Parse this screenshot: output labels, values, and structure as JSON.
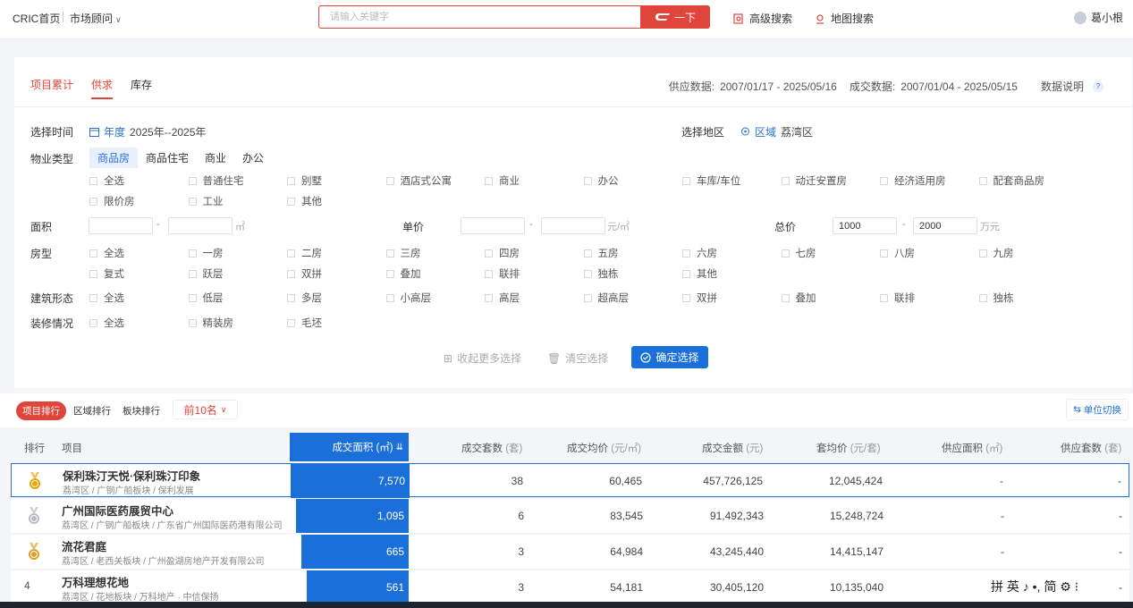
{
  "header": {
    "home": "CRIC首页",
    "advisor": "市场顾问",
    "search_placeholder": "请输入关键字",
    "search_button": "一下",
    "advanced_search": "高级搜索",
    "map_search": "地图搜索",
    "user": "葛小根"
  },
  "tabs": [
    {
      "label": "项目累计"
    },
    {
      "label": "供求"
    },
    {
      "label": "库存"
    }
  ],
  "data_range": {
    "supply_label": "供应数据:",
    "supply_range": "2007/01/17 - 2025/05/16",
    "deal_label": "成交数据:",
    "deal_range": "2007/01/04 - 2025/05/15",
    "note": "数据说明"
  },
  "filters": {
    "time_label": "选择时间",
    "time_type": "年度",
    "time_value": "2025年--2025年",
    "region_label": "选择地区",
    "region_type": "区域",
    "region_value": "荔湾区",
    "property_label": "物业类型",
    "property_types": [
      "商品房",
      "商品住宅",
      "商业",
      "办公"
    ],
    "property_sub": [
      "全选",
      "普通住宅",
      "别墅",
      "酒店式公寓",
      "商业",
      "办公",
      "车库/车位",
      "动迁安置房",
      "经济适用房",
      "配套商品房",
      "限价房",
      "工业",
      "其他"
    ],
    "area_label": "面积",
    "area_unit": "㎡",
    "unit_price_label": "单价",
    "unit_price_unit": "元/㎡",
    "total_price_label": "总价",
    "total_min": "1000",
    "total_max": "2000",
    "total_unit": "万元",
    "room_label": "房型",
    "rooms": [
      "全选",
      "一房",
      "二房",
      "三房",
      "四房",
      "五房",
      "六房",
      "七房",
      "八房",
      "九房",
      "复式",
      "跃层",
      "双拼",
      "叠加",
      "联排",
      "独栋",
      "其他"
    ],
    "building_label": "建筑形态",
    "buildings": [
      "全选",
      "低层",
      "多层",
      "小高层",
      "高层",
      "超高层",
      "双拼",
      "叠加",
      "联排",
      "独栋"
    ],
    "decor_label": "装修情况",
    "decors": [
      "全选",
      "精装房",
      "毛坯"
    ],
    "collapse": "收起更多选择",
    "clear": "清空选择",
    "confirm": "确定选择"
  },
  "ranking": {
    "tabs": [
      "项目排行",
      "区域排行",
      "板块排行"
    ],
    "top": "前10名",
    "unit_switch": "单位切换",
    "columns": {
      "rank": "排行",
      "project": "项目",
      "deal_area": "成交面积",
      "deal_area_unit": "(㎡)",
      "deal_units": "成交套数",
      "deal_units_unit": "(套)",
      "avg_price": "成交均价",
      "avg_price_unit": "(元/㎡)",
      "deal_amount": "成交金额",
      "deal_amount_unit": "(元)",
      "unit_avg": "套均价",
      "unit_avg_unit": "(元/套)",
      "supply_area": "供应面积",
      "supply_area_unit": "(㎡)",
      "supply_units": "供应套数",
      "supply_units_unit": "(套)"
    },
    "rows": [
      {
        "rank": "1",
        "medal": "gold",
        "name": "保利珠汀天悦·保利珠汀印象",
        "sub": "荔湾区 / 广钢广船板块 / 保利发展",
        "area": "7,570",
        "area_frac": 1.0,
        "units": "38",
        "avg": "60,465",
        "amount": "457,726,125",
        "unit_avg": "12,045,424",
        "supply_area": "-",
        "supply_units": "-"
      },
      {
        "rank": "2",
        "medal": "silver",
        "name": "广州国际医药展贸中心",
        "sub": "荔湾区 / 广钢广船板块 / 广东省广州国际医药港有限公司",
        "area": "1,095",
        "area_frac": 0.95,
        "units": "6",
        "avg": "83,545",
        "amount": "91,492,343",
        "unit_avg": "15,248,724",
        "supply_area": "-",
        "supply_units": "-"
      },
      {
        "rank": "3",
        "medal": "bronze",
        "name": "流花君庭",
        "sub": "荔湾区 / 老西关板块 / 广州盈湖房地产开发有限公司",
        "area": "665",
        "area_frac": 0.9,
        "units": "3",
        "avg": "64,984",
        "amount": "43,245,440",
        "unit_avg": "14,415,147",
        "supply_area": "-",
        "supply_units": "-"
      },
      {
        "rank": "4",
        "medal": "",
        "name": "万科理想花地",
        "sub": "荔湾区 / 花地板块 / 万科地产 · 中信保扬",
        "area": "561",
        "area_frac": 0.86,
        "units": "3",
        "avg": "54,181",
        "amount": "30,405,120",
        "unit_avg": "10,135,040",
        "supply_area": "-",
        "supply_units": "-"
      }
    ]
  },
  "ime": "拼 英 ♪ •, 简 ⚙ ⁝",
  "colors": {
    "accent_red": "#e0453b",
    "accent_blue": "#1a6fd8"
  }
}
